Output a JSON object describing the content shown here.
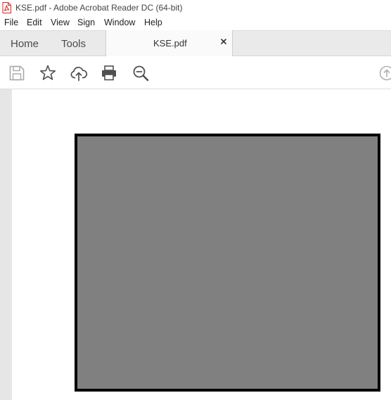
{
  "window": {
    "title": "KSE.pdf - Adobe Acrobat Reader DC (64-bit)",
    "app_icon": "pdf-icon"
  },
  "menu": {
    "items": [
      "File",
      "Edit",
      "View",
      "Sign",
      "Window",
      "Help"
    ]
  },
  "tabs": {
    "home": "Home",
    "tools": "Tools",
    "document": "KSE.pdf",
    "close_icon": "close-icon"
  },
  "toolbar": {
    "icons": [
      "save-icon",
      "bookmark-star-icon",
      "upload-cloud-icon",
      "print-icon",
      "zoom-out-icon",
      "scroll-up-icon"
    ]
  },
  "colors": {
    "accent_red": "#d9261c",
    "page_fill": "#808080",
    "page_border": "#000000"
  }
}
